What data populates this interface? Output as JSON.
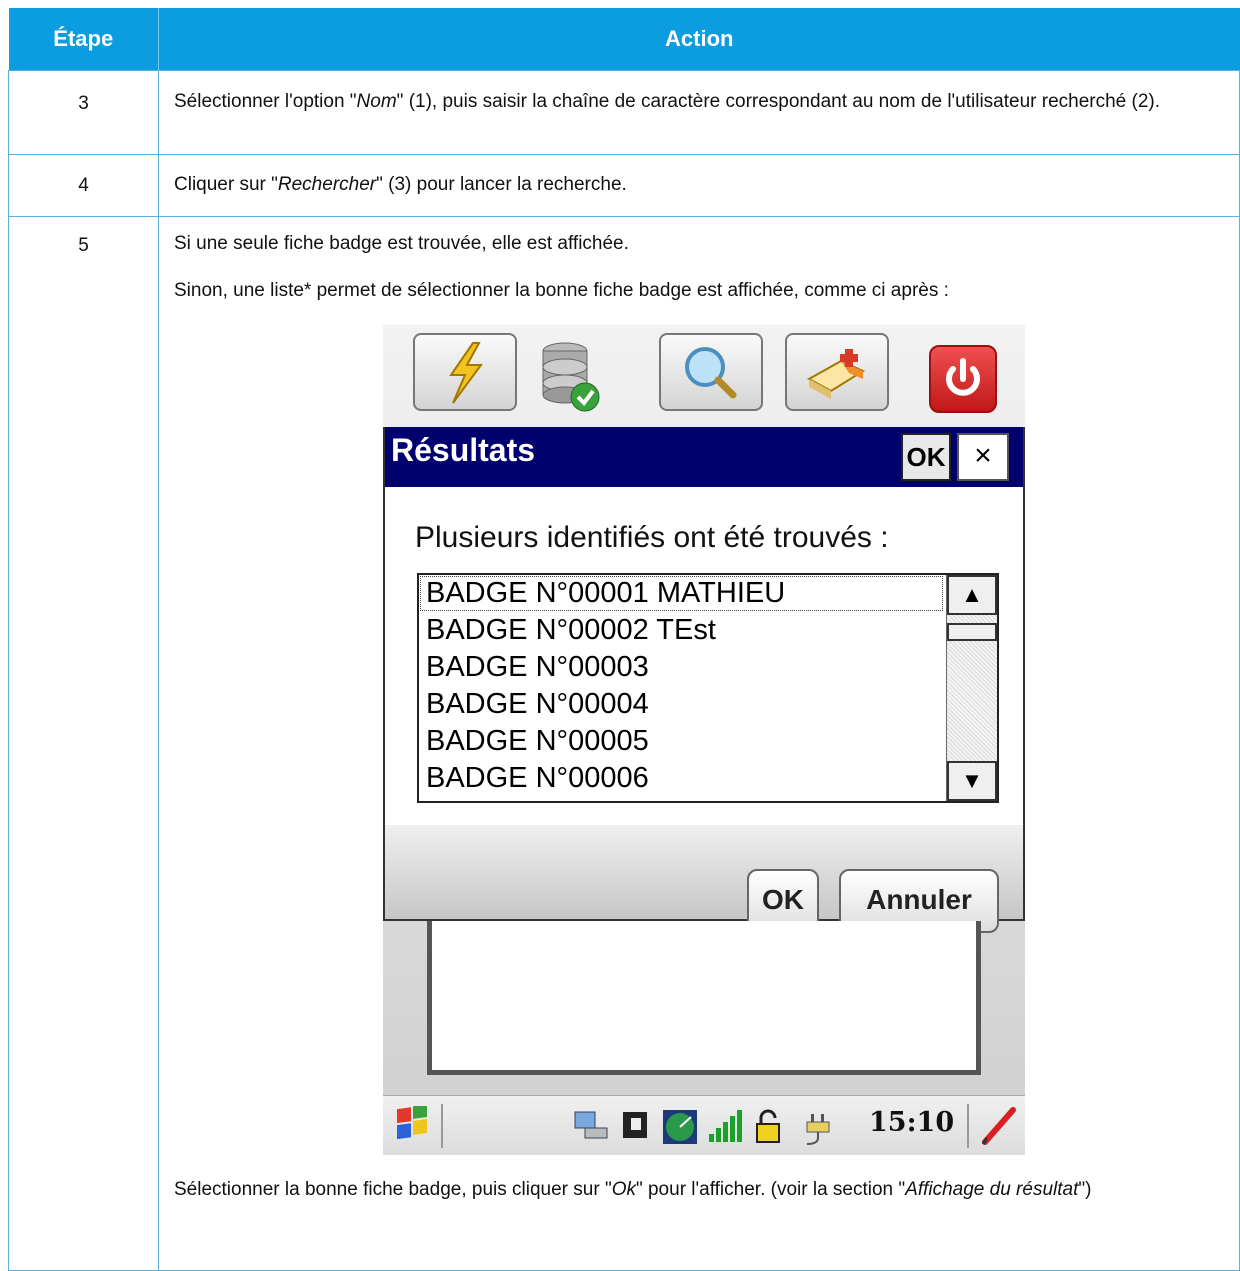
{
  "table": {
    "headers": [
      "Étape",
      "Action"
    ],
    "rows": [
      {
        "step": "3",
        "action": "Sélectionner l'option \"Nom\" (1), puis saisir la chaîne de caractère correspondant au nom de l'utilisateur recherché (2)."
      },
      {
        "step": "4",
        "action": "Cliquer sur \"Rechercher\" (3) pour lancer la recherche."
      },
      {
        "step": "5",
        "action_p1": "Si une seule fiche badge est trouvée, elle est affichée.",
        "action_p2": "Sinon, une liste* permet de sélectionner la bonne fiche badge est affichée, comme ci après :",
        "action_p3": "Sélectionner la bonne fiche badge, puis cliquer sur \"Ok\" pour l'afficher. (voir la section \"Affichage du résultat\")"
      }
    ]
  },
  "row3_parts": [
    "Sélectionner l'option \"",
    "Nom",
    "\" (1), puis saisir la chaîne de caractère correspondant au nom de l'utilisateur recherché (2)."
  ],
  "row4_parts": [
    "Cliquer sur \"",
    "Rechercher",
    "\" (3) pour lancer la recherche."
  ],
  "row5_p3_parts": [
    "Sélectionner la bonne fiche badge, puis cliquer sur \"",
    "Ok",
    "\" pour l'afficher. (voir la section \"",
    "Affichage du résultat",
    "\")"
  ],
  "pda": {
    "toolbar_icons": [
      "lightning-icon",
      "database-check-icon",
      "magnifier-icon",
      "eraser-icon",
      "power-icon"
    ],
    "dialog": {
      "title": "Résultats",
      "title_ok": "OK",
      "title_close": "×",
      "prompt": "Plusieurs identifiés ont été trouvés :",
      "items": [
        "BADGE N°00001 MATHIEU",
        "BADGE N°00002 TEst",
        "BADGE N°00003",
        "BADGE N°00004",
        "BADGE N°00005",
        "BADGE N°00006"
      ],
      "selected_index": 0,
      "ok_label": "OK",
      "cancel_label": "Annuler"
    },
    "taskbar": {
      "time": "15:10"
    }
  },
  "colors": {
    "header_bg": "#0c9de0",
    "border": "#5ab1df",
    "dialog_title_bg": "#00006e"
  }
}
